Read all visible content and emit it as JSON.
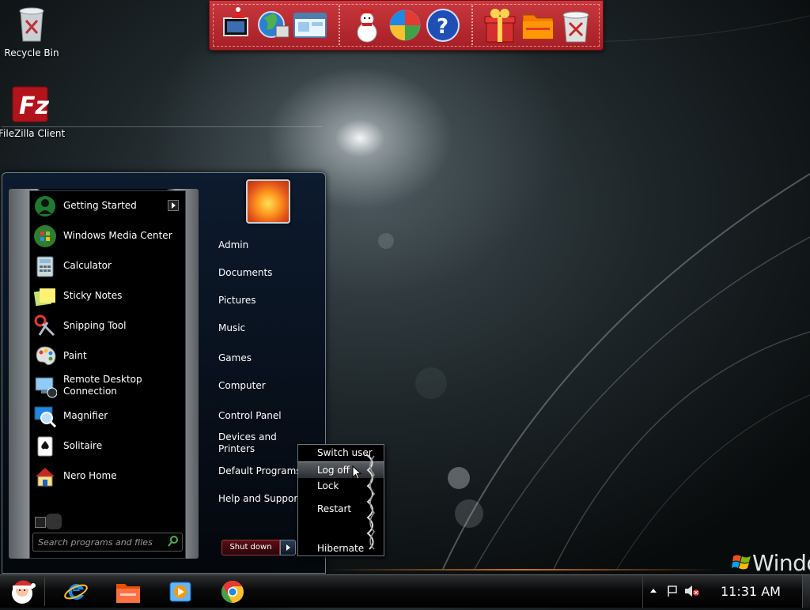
{
  "desktop": {
    "icons": [
      {
        "label": "Recycle Bin",
        "icon": "recycle-bin-icon"
      },
      {
        "label": "FileZilla Client",
        "icon": "filezilla-icon"
      }
    ],
    "brand_text": "Windo"
  },
  "dock": {
    "icons": [
      "christmas-computer-icon",
      "globe-icon",
      "network-window-icon",
      "snowman-icon",
      "windows-media-icon",
      "help-icon",
      "gift-icon",
      "folder-icon",
      "trash-icon"
    ]
  },
  "start_menu": {
    "programs": [
      {
        "label": "Getting Started",
        "icon": "getting-started-icon",
        "has_submenu": true
      },
      {
        "label": "Windows Media Center",
        "icon": "media-center-icon"
      },
      {
        "label": "Calculator",
        "icon": "calculator-icon"
      },
      {
        "label": "Sticky Notes",
        "icon": "sticky-notes-icon"
      },
      {
        "label": "Snipping Tool",
        "icon": "snipping-tool-icon"
      },
      {
        "label": "Paint",
        "icon": "paint-icon"
      },
      {
        "label": "Remote Desktop\nConnection",
        "line1": "Remote Desktop",
        "line2": "Connection",
        "icon": "remote-desktop-icon"
      },
      {
        "label": "Magnifier",
        "icon": "magnifier-icon"
      },
      {
        "label": "Solitaire",
        "icon": "solitaire-icon"
      },
      {
        "label": "Nero Home",
        "icon": "nero-home-icon"
      }
    ],
    "search_placeholder": "Search programs and files",
    "right_links": [
      {
        "label": "Admin"
      },
      {
        "label": "Documents"
      },
      {
        "label": "Pictures"
      },
      {
        "label": "Music"
      },
      {
        "label": "Games"
      },
      {
        "label": "Computer"
      },
      {
        "label": "Control Panel"
      },
      {
        "line1": "Devices and",
        "line2": "Printers"
      },
      {
        "label": "Default Programs"
      },
      {
        "label": "Help and Support"
      }
    ],
    "shutdown_label": "Shut down"
  },
  "power_menu": {
    "items": [
      "Switch user",
      "Log off",
      "Lock",
      "Restart",
      "Hibernate"
    ],
    "highlighted": "Log off"
  },
  "taskbar": {
    "pinned": [
      "internet-explorer-icon",
      "file-explorer-icon",
      "media-player-icon",
      "chrome-icon"
    ],
    "clock": "11:31 AM"
  },
  "colors": {
    "dock_red": "#b8272e",
    "start_menu_bg": "#0d1b2e",
    "shutdown_red": "#5a1015"
  }
}
